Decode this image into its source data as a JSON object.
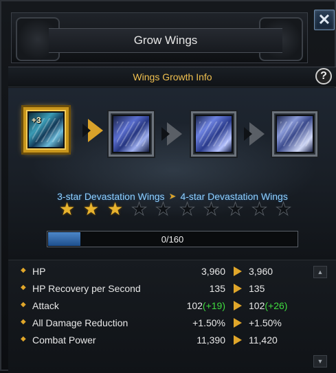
{
  "window": {
    "title": "Grow Wings",
    "close_icon": "close-icon",
    "close_glyph": "✕"
  },
  "section": {
    "title": "Wings Growth Info",
    "help_glyph": "?"
  },
  "growth": {
    "current_plus": "+3",
    "current_stage": "3-star Devastation Wings",
    "next_stage": "4-star Devastation Wings",
    "stars_total": 10,
    "stars_filled": 3,
    "progress_text": "0/160",
    "progress_fraction": 0.13
  },
  "stats": [
    {
      "name": "HP",
      "current": "3,960",
      "current_bonus": "",
      "next": "3,960",
      "next_bonus": ""
    },
    {
      "name": "HP Recovery per Second",
      "current": "135",
      "current_bonus": "",
      "next": "135",
      "next_bonus": ""
    },
    {
      "name": "Attack",
      "current": "102",
      "current_bonus": "(+19)",
      "next": "102",
      "next_bonus": "(+26)"
    },
    {
      "name": "All Damage Reduction",
      "current": "+1.50%",
      "current_bonus": "",
      "next": "+1.50%",
      "next_bonus": ""
    },
    {
      "name": "Combat Power",
      "current": "11,390",
      "current_bonus": "",
      "next": "11,420",
      "next_bonus": ""
    }
  ],
  "colors": {
    "gold_accent": "#e0a62a",
    "section_title": "#f0c050",
    "evo_text": "#8fd0ff",
    "bonus_green": "#3fdc3f"
  }
}
